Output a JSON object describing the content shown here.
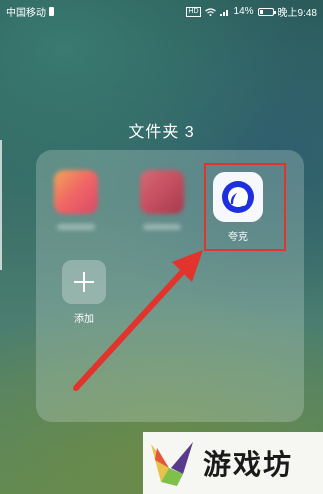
{
  "status_bar": {
    "carrier": "中国移动",
    "network": "HD",
    "battery_percent": "14%",
    "time": "晚上9:48"
  },
  "folder": {
    "title": "文件夹 3",
    "apps": [
      {
        "label": "夸克",
        "icon": "quark-logo-icon",
        "highlighted": true
      }
    ],
    "add_label": "添加"
  },
  "watermark": {
    "text": "游戏坊"
  },
  "colors": {
    "highlight": "#e0342c",
    "quark_blue": "#1d2fe0"
  }
}
